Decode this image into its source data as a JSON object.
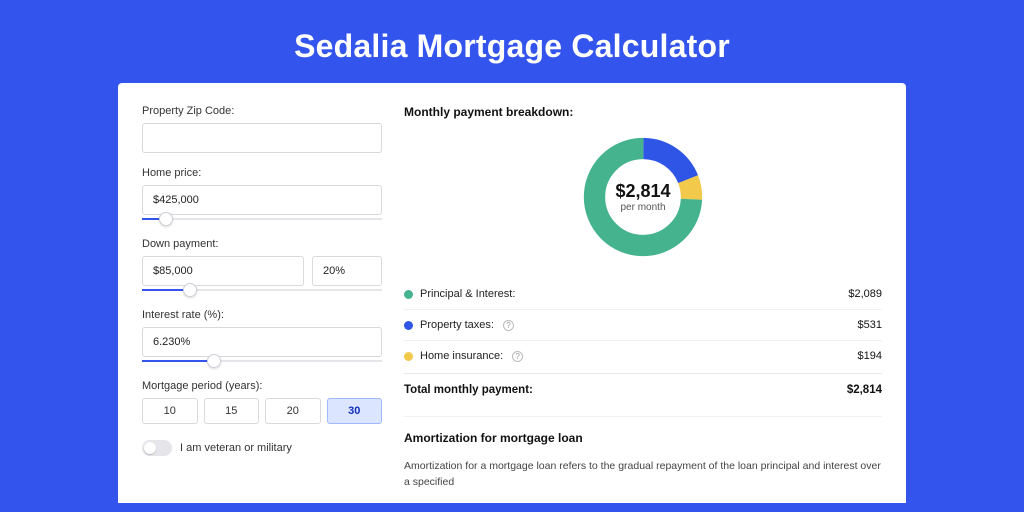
{
  "title": "Sedalia Mortgage Calculator",
  "colors": {
    "principal": "#45b48e",
    "taxes": "#2f55e6",
    "insurance": "#f3c94c"
  },
  "form": {
    "zip": {
      "label": "Property Zip Code:",
      "value": ""
    },
    "home_price": {
      "label": "Home price:",
      "value": "$425,000",
      "slider_pct": 10
    },
    "down_payment": {
      "label": "Down payment:",
      "value": "$85,000",
      "pct_value": "20%",
      "slider_pct": 20
    },
    "interest_rate": {
      "label": "Interest rate (%):",
      "value": "6.230%",
      "slider_pct": 30
    },
    "period": {
      "label": "Mortgage period (years):",
      "options": [
        "10",
        "15",
        "20",
        "30"
      ],
      "selected": "30"
    },
    "veteran": {
      "label": "I am veteran or military",
      "checked": false
    }
  },
  "breakdown": {
    "title": "Monthly payment breakdown:",
    "center_value": "$2,814",
    "center_sub": "per month",
    "items": [
      {
        "label": "Principal & Interest:",
        "value": "$2,089",
        "has_info": false,
        "color_key": "principal"
      },
      {
        "label": "Property taxes:",
        "value": "$531",
        "has_info": true,
        "color_key": "taxes"
      },
      {
        "label": "Home insurance:",
        "value": "$194",
        "has_info": true,
        "color_key": "insurance"
      }
    ],
    "total_label": "Total monthly payment:",
    "total_value": "$2,814"
  },
  "chart_data": {
    "type": "pie",
    "title": "Monthly payment breakdown",
    "series": [
      {
        "name": "Principal & Interest",
        "value": 2089
      },
      {
        "name": "Property taxes",
        "value": 531
      },
      {
        "name": "Home insurance",
        "value": 194
      }
    ],
    "total": 2814
  },
  "amortization": {
    "title": "Amortization for mortgage loan",
    "text": "Amortization for a mortgage loan refers to the gradual repayment of the loan principal and interest over a specified"
  }
}
